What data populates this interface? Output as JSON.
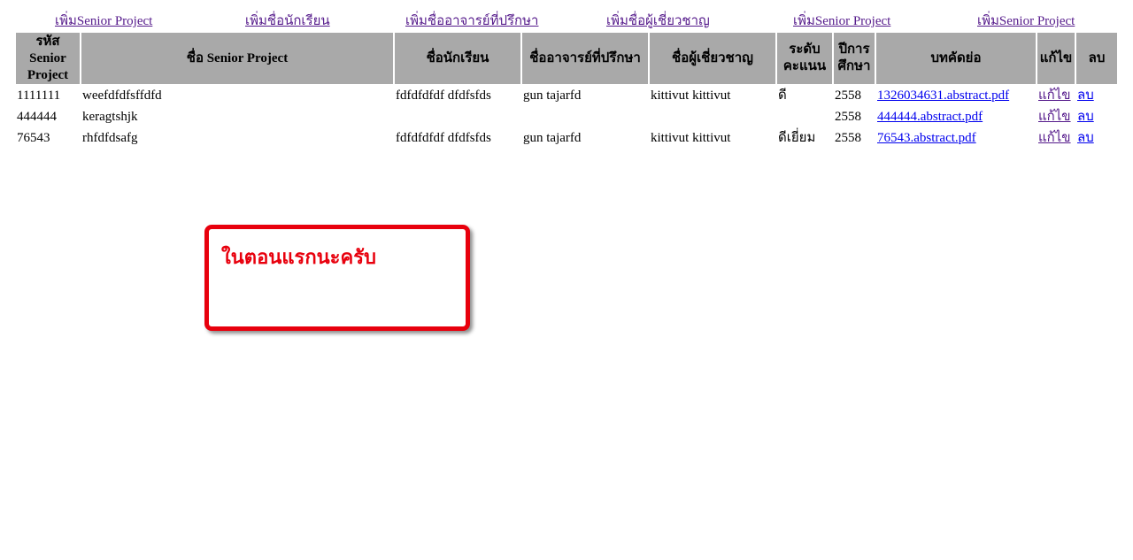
{
  "nav": {
    "links": [
      "เพิ่มSenior Project",
      "เพิ่มชื่อนักเรียน",
      "เพิ่มชื่ออาจารย์ที่ปรึกษา",
      "เพิ่มชื่อผู้เชี่ยวชาญ",
      "เพิ่มSenior Project",
      "เพิ่มSenior Project"
    ]
  },
  "table": {
    "headers": {
      "id": "รหัส Senior Project",
      "name": "ชื่อ Senior Project",
      "student": "ชื่อนักเรียน",
      "advisor": "ชื่ออาจารย์ที่ปรึกษา",
      "expert": "ชื่อผู้เชี่ยวชาญ",
      "grade": "ระดับคะแนน",
      "year": "ปีการศึกษา",
      "abstract": "บทคัดย่อ",
      "edit": "แก้ไข",
      "delete": "ลบ"
    },
    "rows": [
      {
        "id": "1111111",
        "name": "weefdfdfsffdfd",
        "student": "fdfdfdfdf dfdfsfds",
        "advisor": "gun tajarfd",
        "expert": "kittivut kittivut",
        "grade": "ดี",
        "year": "2558",
        "abstract": "1326034631.abstract.pdf",
        "edit": "แก้ไข",
        "delete": "ลบ"
      },
      {
        "id": "444444",
        "name": "keragtshjk",
        "student": "",
        "advisor": "",
        "expert": "",
        "grade": "",
        "year": "2558",
        "abstract": "444444.abstract.pdf",
        "edit": "แก้ไข",
        "delete": "ลบ"
      },
      {
        "id": "76543",
        "name": "rhfdfdsafg",
        "student": "fdfdfdfdf dfdfsfds",
        "advisor": "gun tajarfd",
        "expert": "kittivut kittivut",
        "grade": "ดีเยี่ยม",
        "year": "2558",
        "abstract": "76543.abstract.pdf",
        "edit": "แก้ไข",
        "delete": "ลบ"
      }
    ]
  },
  "callout": {
    "text": "ในตอนแรกนะครับ",
    "color": "#e8000d"
  }
}
